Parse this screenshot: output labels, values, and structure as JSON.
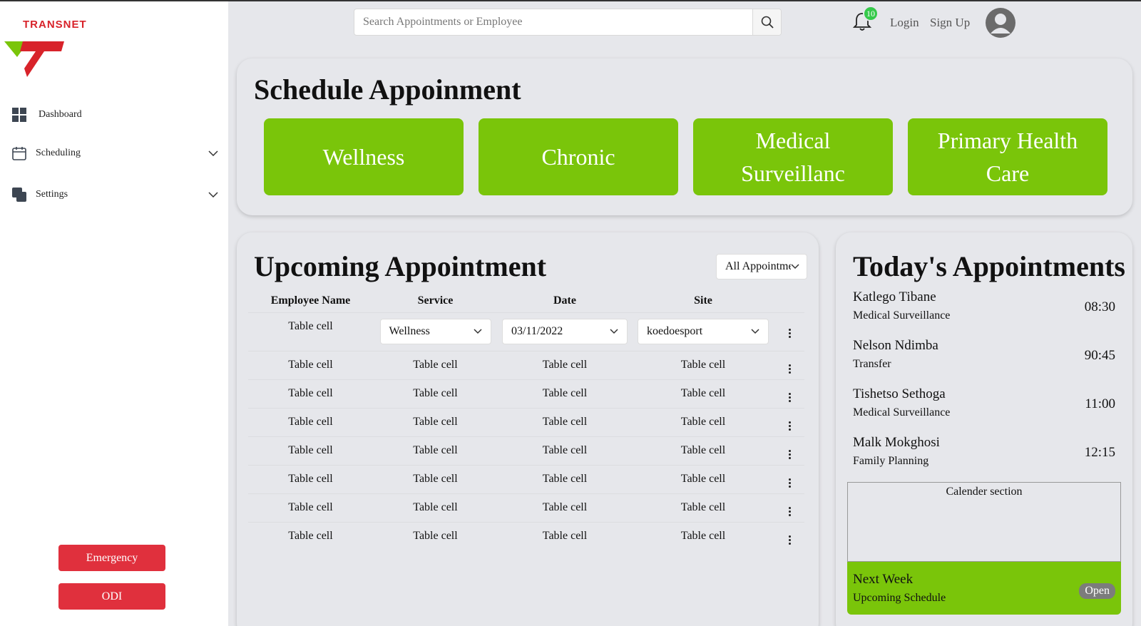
{
  "brand": {
    "logo_text": "TRANSNET",
    "accent": "#d8232a",
    "green": "#7ac50a"
  },
  "sidebar": {
    "items": [
      {
        "label": "Dashboard",
        "icon": "grid-icon"
      },
      {
        "label": "Scheduling",
        "icon": "calendar-icon"
      },
      {
        "label": "Settings",
        "icon": "layers-icon"
      }
    ],
    "emergency_label": "Emergency",
    "odi_label": "ODI"
  },
  "header": {
    "search_placeholder": "Search Appointments or Employee",
    "notification_count": "10",
    "login_label": "Login",
    "signup_label": "Sign Up"
  },
  "schedule": {
    "title": "Schedule Appoinment",
    "services": [
      "Wellness",
      "Chronic",
      "Medical Surveillanc",
      "Primary Health Care"
    ]
  },
  "upcoming": {
    "title": "Upcoming Appointment",
    "filter_value": "All Appointments",
    "columns": [
      "Employee Name",
      "Service",
      "Date",
      "Site"
    ],
    "first_row": {
      "name": "Table cell",
      "service": "Wellness",
      "date": "03/11/2022",
      "site": "koedoesport"
    },
    "cell_text": "Table cell"
  },
  "today": {
    "title": "Today's Appointments",
    "appointments": [
      {
        "name": "Katlego Tibane",
        "service": "Medical Surveillance",
        "time": "08:30"
      },
      {
        "name": "Nelson Ndimba",
        "service": "Transfer",
        "time": "90:45"
      },
      {
        "name": "Tishetso Sethoga",
        "service": "Medical Surveillance",
        "time": "11:00"
      },
      {
        "name": "Malk Mokghosi",
        "service": "Family Planning",
        "time": "12:15"
      }
    ],
    "calendar_label": "Calender section",
    "next_week_title": "Next Week",
    "next_week_subtitle": "Upcoming Schedule",
    "open_label": "Open"
  }
}
